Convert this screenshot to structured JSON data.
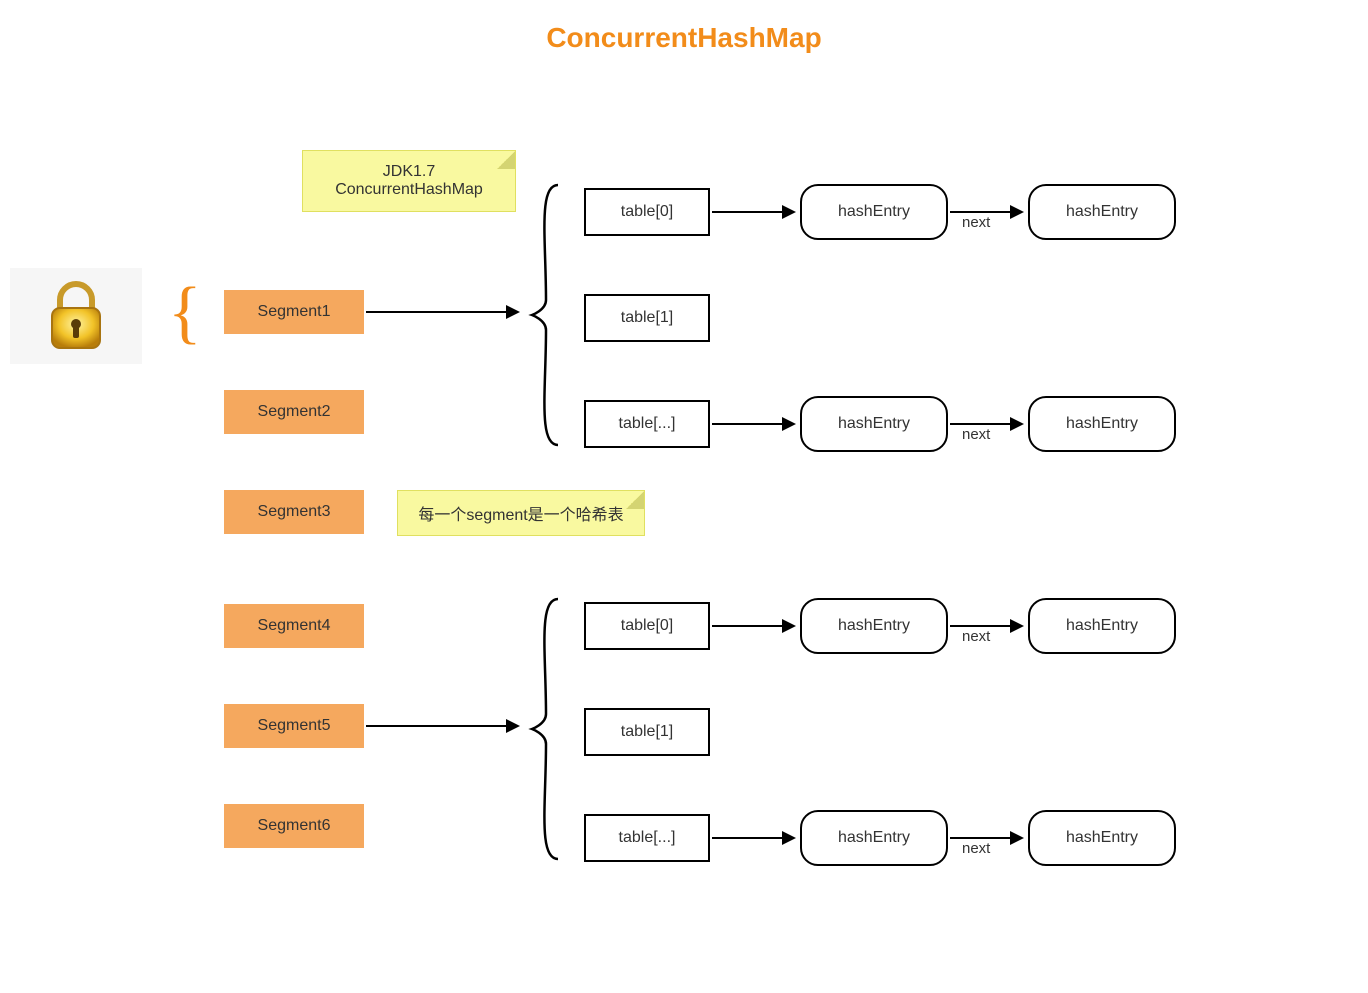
{
  "title": "ConcurrentHashMap",
  "note1_line1": "JDK1.7",
  "note1_line2": "ConcurrentHashMap",
  "note2": "每一个segment是一个哈希表",
  "segments": {
    "s1": "Segment1",
    "s2": "Segment2",
    "s3": "Segment3",
    "s4": "Segment4",
    "s5": "Segment5",
    "s6": "Segment6"
  },
  "tables": {
    "t0": "table[0]",
    "t1": "table[1]",
    "tn": "table[...]"
  },
  "entry": "hashEntry",
  "next": "next",
  "colors": {
    "accent": "#f28c1a",
    "segment": "#f5a85e",
    "note": "#f9f9a0"
  }
}
